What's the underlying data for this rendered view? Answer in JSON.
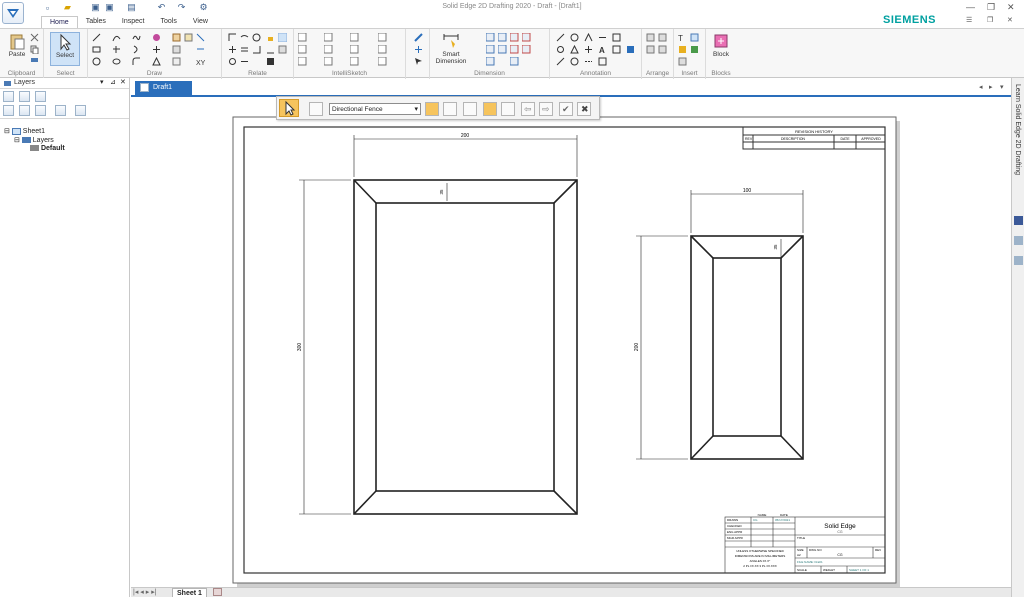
{
  "window": {
    "title": "Solid Edge 2D Drafting 2020 - Draft - [Draft1]",
    "brand": "SIEMENS"
  },
  "tabs": [
    "Home",
    "Tables",
    "Inspect",
    "Tools",
    "View"
  ],
  "ribbon": {
    "clipboard": {
      "paste_label": "Paste",
      "group_label": "Clipboard"
    },
    "select": {
      "button_label": "Select",
      "group_label": "Select"
    },
    "draw": {
      "group_label": "Draw"
    },
    "relate": {
      "group_label": "Relate"
    },
    "intellisketch": {
      "group_label": "IntelliSketch"
    },
    "dimension": {
      "button_label_line1": "Smart",
      "button_label_line2": "Dimension",
      "group_label": "Dimension"
    },
    "annotation": {
      "group_label": "Annotation"
    },
    "arrange": {
      "group_label": "Arrange"
    },
    "insert": {
      "group_label": "Insert"
    },
    "blocks": {
      "button_label": "Block",
      "group_label": "Blocks"
    }
  },
  "left_panel": {
    "title": "Layers",
    "tree": {
      "sheet": "Sheet1",
      "layers": "Layers",
      "default": "Default"
    }
  },
  "document": {
    "tab_label": "Draft1",
    "sheet_tab": "Sheet 1",
    "right_panel_title": "Learn Solid Edge 2D Drafting"
  },
  "command_bar": {
    "fence_option": "Directional Fence"
  },
  "drawing": {
    "left_frame": {
      "width_dim": "200",
      "height_dim": "300",
      "border_dim": "35"
    },
    "right_frame": {
      "width_dim": "100",
      "height_dim": "200",
      "border_dim": "35"
    },
    "revision_block": {
      "header": "REVISION HISTORY",
      "cols": [
        "REV",
        "DESCRIPTION",
        "DATE",
        "APPROVED"
      ]
    },
    "title_block": {
      "company": "Solid Edge",
      "title_label": "TITLE",
      "name_col": "NAME",
      "date_col": "DATE",
      "rows": [
        "DRAWN",
        "CHECKED",
        "ENG APPR",
        "MGR APPR"
      ],
      "drawn_by": "CG",
      "drawn_date": "05/17/2021",
      "note_line1": "UNLESS OTHERWISE SPECIFIED",
      "note_line2": "DIMENSIONS ARE IN MILLIMETERS",
      "note_line3": "ANGLES ±X.X°",
      "note_line4": "2 PL ±X.XX 3 PL ±X.XXX",
      "size_label": "SIZE",
      "size_value": "A2",
      "dwg_label": "DWG NO",
      "dwg_value": "CG",
      "rev_label": "REV",
      "file_name": "FILE NAME: Draft1",
      "scale_label": "SCALE",
      "weight_label": "WEIGHT",
      "sheet_label": "SHEET 1 OF 1",
      "company_sub": "CG"
    }
  }
}
